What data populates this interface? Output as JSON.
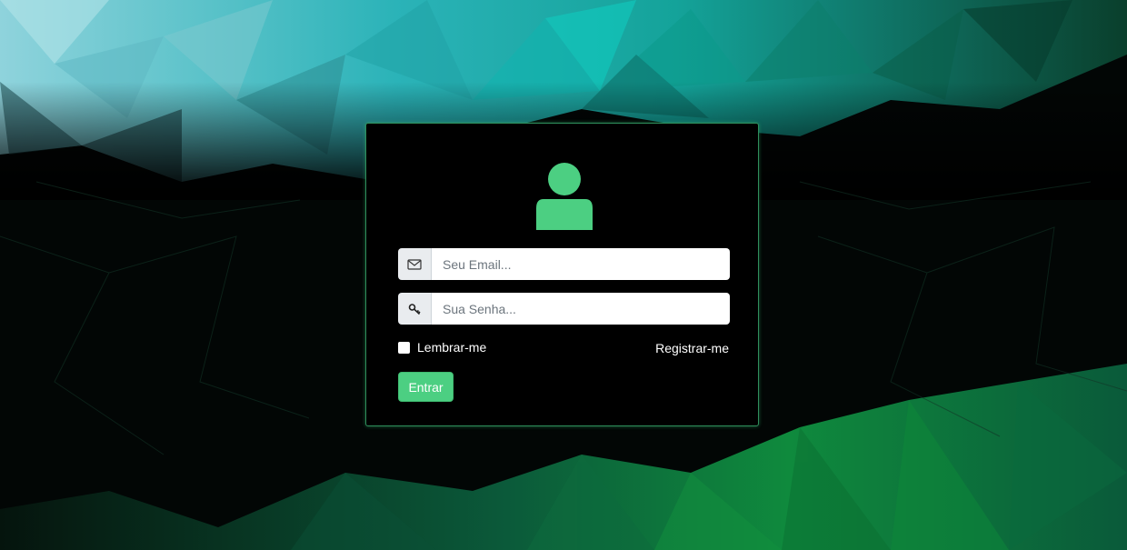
{
  "colors": {
    "accent": "#4ccf82",
    "card_background": "#000000",
    "card_border": "#2f8f5c"
  },
  "login": {
    "avatar_icon": "user-icon",
    "email": {
      "icon": "envelope-icon",
      "placeholder": "Seu Email...",
      "value": ""
    },
    "password": {
      "icon": "key-icon",
      "placeholder": "Sua Senha...",
      "value": ""
    },
    "remember_label": "Lembrar-me",
    "remember_checked": false,
    "register_label": "Registrar-me",
    "submit_label": "Entrar"
  }
}
